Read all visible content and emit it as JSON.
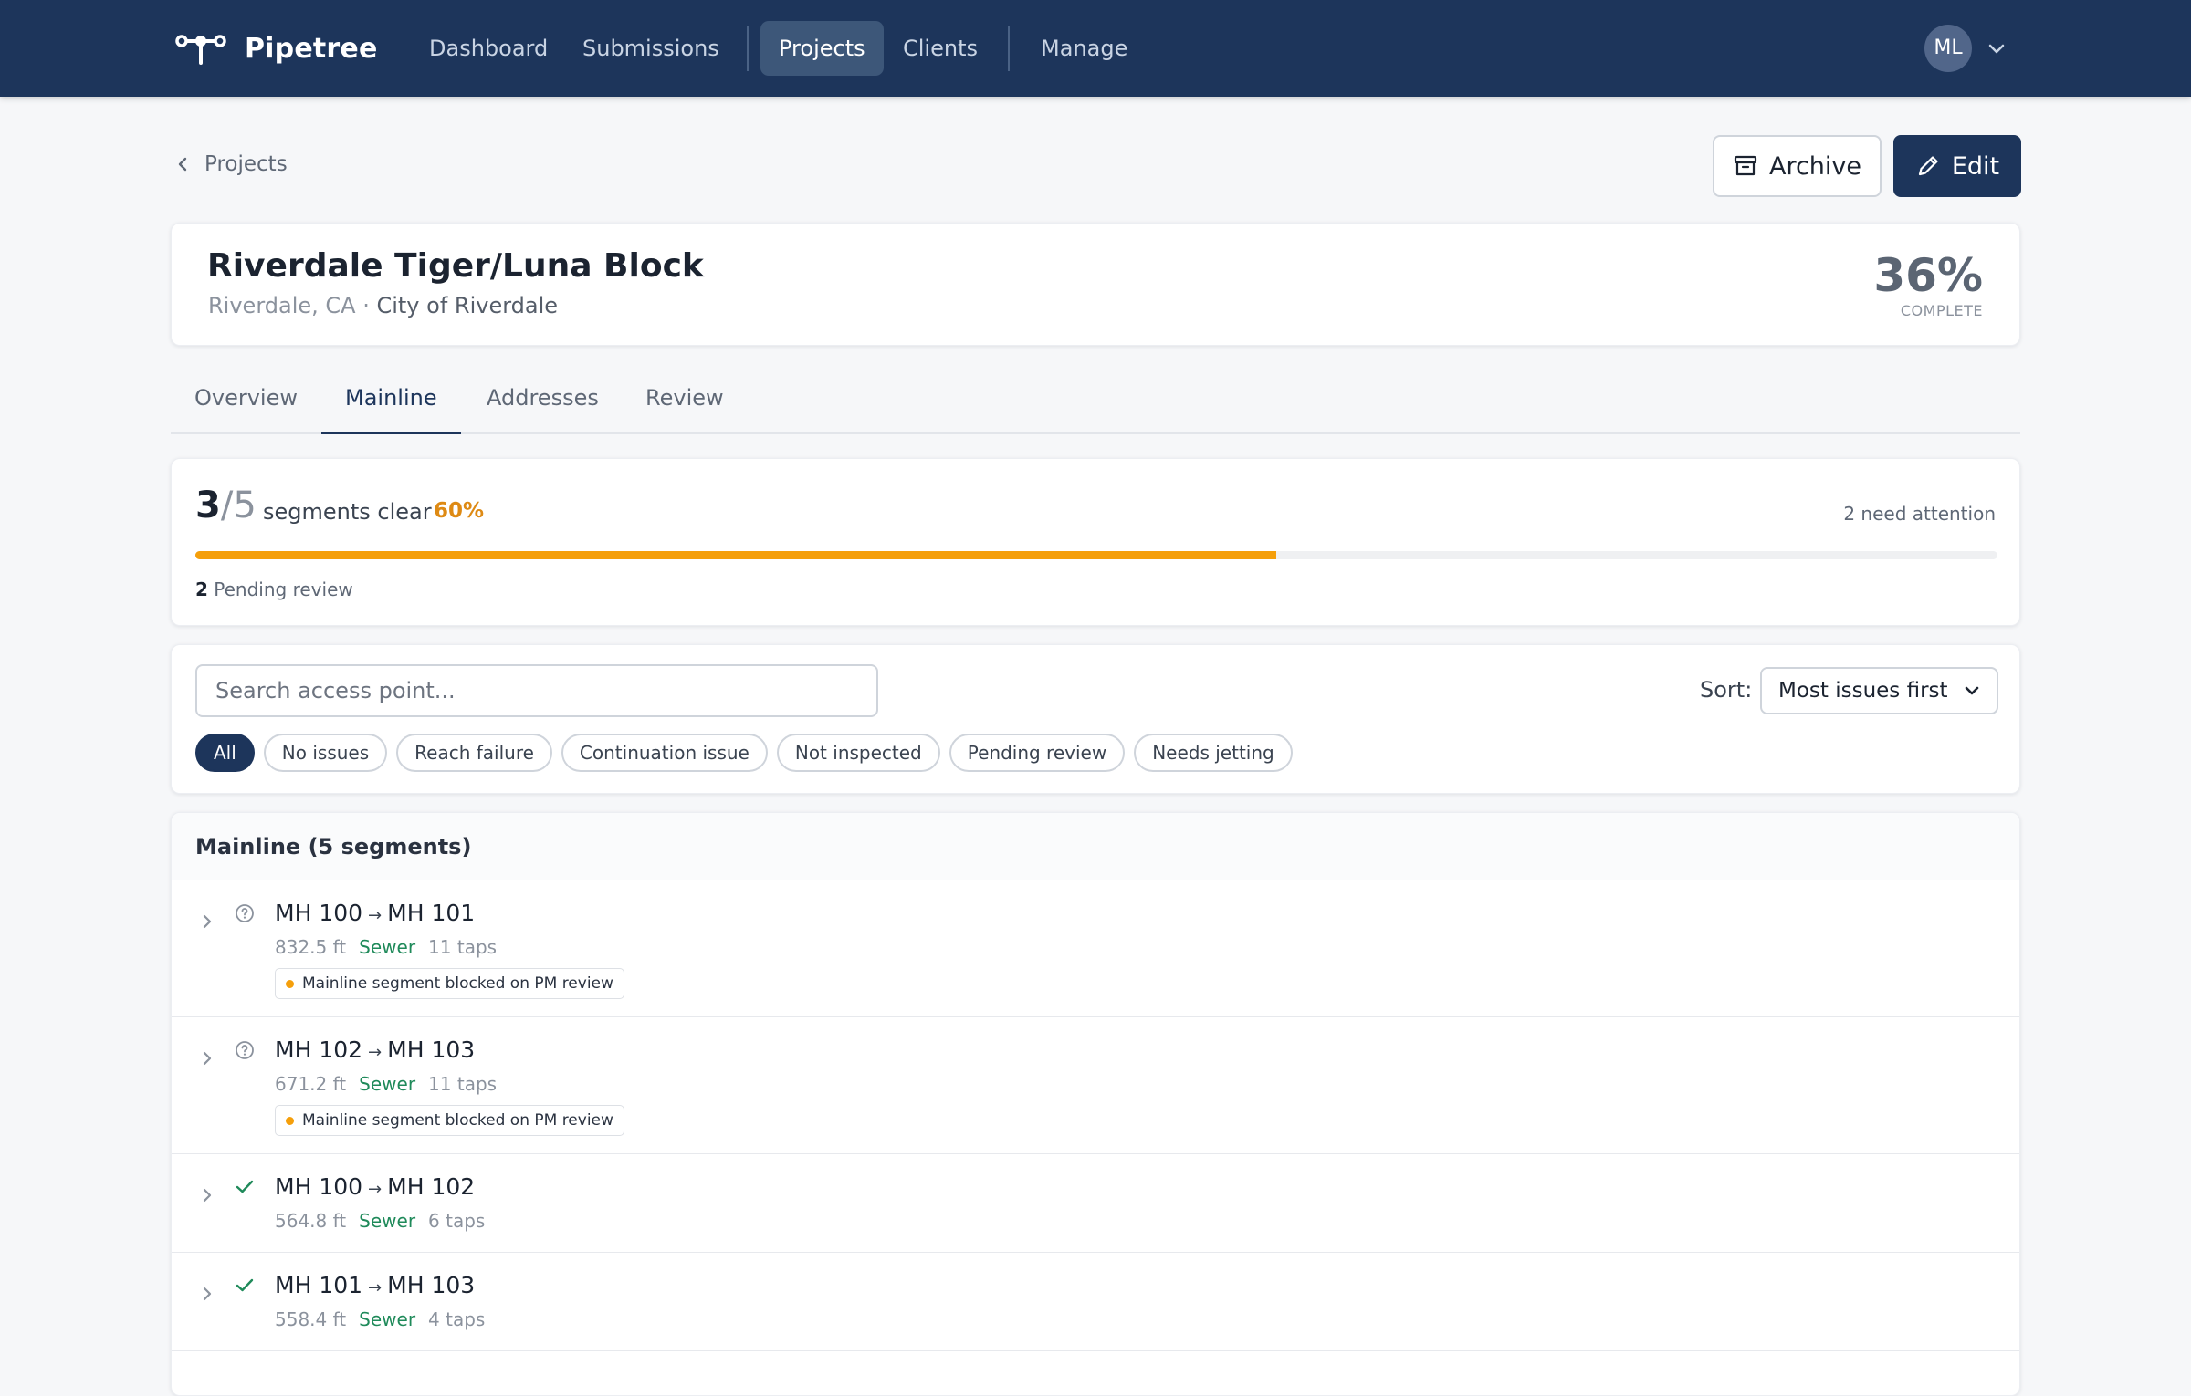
{
  "app": {
    "name": "Pipetree"
  },
  "nav": {
    "items": [
      {
        "label": "Dashboard"
      },
      {
        "label": "Submissions"
      },
      {
        "label": "Projects",
        "active": true
      },
      {
        "label": "Clients"
      },
      {
        "label": "Manage"
      }
    ],
    "avatar_initials": "ML"
  },
  "breadcrumb": {
    "back_label": "Projects"
  },
  "actions": {
    "archive_label": "Archive",
    "edit_label": "Edit"
  },
  "project": {
    "title": "Riverdale Tiger/Luna Block",
    "location": "Riverdale, CA",
    "separator": " · ",
    "client": "City of Riverdale",
    "percent_label": "36%",
    "percent_caption": "COMPLETE"
  },
  "tabs": [
    {
      "label": "Overview"
    },
    {
      "label": "Mainline",
      "active": true
    },
    {
      "label": "Addresses"
    },
    {
      "label": "Review"
    }
  ],
  "stats": {
    "cleared": "3",
    "total": "/5",
    "label": "segments clear",
    "percent_label": "60%",
    "progress_fraction": 0.6,
    "attention_text": "2 need attention",
    "pending_count": "2",
    "pending_label": "Pending review"
  },
  "filters": {
    "search_placeholder": "Search access point...",
    "sort_label": "Sort:",
    "sort_value": "Most issues first",
    "chips": [
      {
        "label": "All",
        "active": true
      },
      {
        "label": "No issues"
      },
      {
        "label": "Reach failure"
      },
      {
        "label": "Continuation issue"
      },
      {
        "label": "Not inspected"
      },
      {
        "label": "Pending review"
      },
      {
        "label": "Needs jetting"
      }
    ]
  },
  "mainline": {
    "header": "Mainline (5 segments)",
    "arrow": "→",
    "rows": [
      {
        "from": "MH 100",
        "to": "MH 101",
        "length": "832.5 ft",
        "type": "Sewer",
        "taps": "11 taps",
        "status_icon": "question-circle-icon",
        "flag": "Mainline segment blocked on PM review"
      },
      {
        "from": "MH 102",
        "to": "MH 103",
        "length": "671.2 ft",
        "type": "Sewer",
        "taps": "11 taps",
        "status_icon": "question-circle-icon",
        "flag": "Mainline segment blocked on PM review"
      },
      {
        "from": "MH 100",
        "to": "MH 102",
        "length": "564.8 ft",
        "type": "Sewer",
        "taps": "6 taps",
        "status_icon": "check-icon"
      },
      {
        "from": "MH 101",
        "to": "MH 103",
        "length": "558.4 ft",
        "type": "Sewer",
        "taps": "4 taps",
        "status_icon": "check-icon"
      }
    ]
  },
  "colors": {
    "navbar": "#1d355b",
    "accent": "#f59f0b",
    "sewer": "#1f8a5a",
    "check": "#1f8a5a"
  }
}
